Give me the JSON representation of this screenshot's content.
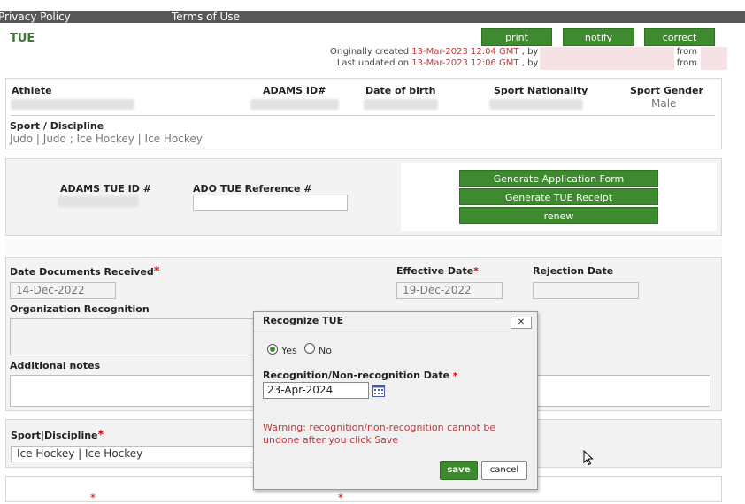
{
  "nav": {
    "privacy": "Privacy Policy",
    "terms": "Terms of Use"
  },
  "page": {
    "title": "TUE"
  },
  "actions": {
    "print": "print",
    "notify": "notify",
    "correct": "correct"
  },
  "meta": {
    "created_prefix": "Originally created",
    "created_date": "13-Mar-2023 12:04 GMT",
    "updated_prefix": "Last updated on",
    "updated_date": "13-Mar-2023 12:06 GMT",
    "by": ", by",
    "from": "from"
  },
  "athlete": {
    "athlete_label": "Athlete",
    "adams_id_label": "ADAMS ID#",
    "dob_label": "Date of birth",
    "nationality_label": "Sport Nationality",
    "gender_label": "Sport Gender",
    "gender_value": "Male",
    "sport_label": "Sport / Discipline",
    "sport_value": "Judo | Judo ; Ice Hockey | Ice Hockey"
  },
  "tue_ids": {
    "adams_tue_label": "ADAMS TUE ID #",
    "ado_ref_label": "ADO TUE Reference #",
    "generate_form": "Generate Application Form",
    "generate_receipt": "Generate TUE Receipt",
    "renew": "renew"
  },
  "dates": {
    "docs_received_label": "Date Documents Received",
    "docs_received_value": "14-Dec-2022",
    "effective_label": "Effective Date",
    "effective_value": "19-Dec-2022",
    "rejection_label": "Rejection Date",
    "rejection_value": "",
    "org_recognition_label": "Organization Recognition",
    "additional_notes_label": "Additional notes",
    "required_mark": "*"
  },
  "sport_section": {
    "label": "Sport|Discipline",
    "value": "Ice Hockey | Ice Hockey"
  },
  "modal": {
    "title": "Recognize TUE",
    "close": "✕",
    "yes_label": "Yes",
    "no_label": "No",
    "selected": "Yes",
    "date_label": "Recognition/Non-recognition Date",
    "date_value": "23-Apr-2024",
    "warning": "Warning: recognition/non-recognition cannot be undone after you click Save",
    "save": "save",
    "cancel": "cancel"
  },
  "colors": {
    "accent_green": "#3e8a2e",
    "title_green": "#3a7a2f",
    "date_red": "#c0393b"
  }
}
